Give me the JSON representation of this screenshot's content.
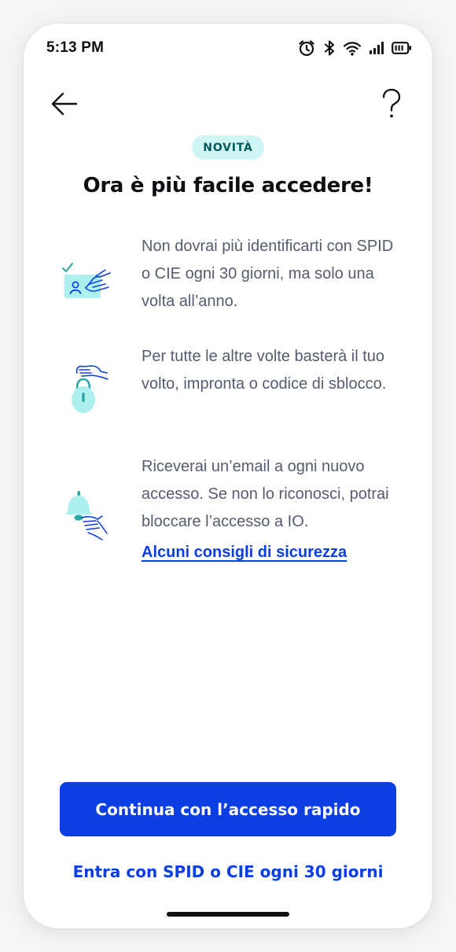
{
  "status_bar": {
    "time": "5:13 PM",
    "icons": [
      "alarm-icon",
      "bluetooth-icon",
      "wifi-icon",
      "signal-icon",
      "battery-icon"
    ]
  },
  "header": {
    "back_icon": "arrow-left-icon",
    "help_icon": "question-mark-icon"
  },
  "badge": "NOVITÀ",
  "title": "Ora è più facile accedere!",
  "features": [
    {
      "icon": "identity-card-hand-icon",
      "text": "Non dovrai più identificarti con SPID o CIE ogni 30 giorni, ma solo una volta all’anno."
    },
    {
      "icon": "padlock-hand-icon",
      "text": "Per tutte le altre volte basterà il tuo volto, impronta o codice di sblocco."
    },
    {
      "icon": "bell-hand-icon",
      "text": "Riceverai un’email a ogni nuovo accesso. Se non lo riconosci, potrai bloccare l’accesso a IO."
    }
  ],
  "security_link": "Alcuni consigli di sicurezza",
  "primary_action": "Continua con l’accesso rapido",
  "secondary_action": "Entra con SPID o CIE ogni 30 giorni",
  "colors": {
    "accent": "#0b3ee3",
    "badge_bg": "#cff5f4",
    "badge_text": "#055a5a",
    "illustration_teal": "#aef0ee",
    "illustration_blue": "#0b3ee3",
    "body_text": "#555c70"
  }
}
